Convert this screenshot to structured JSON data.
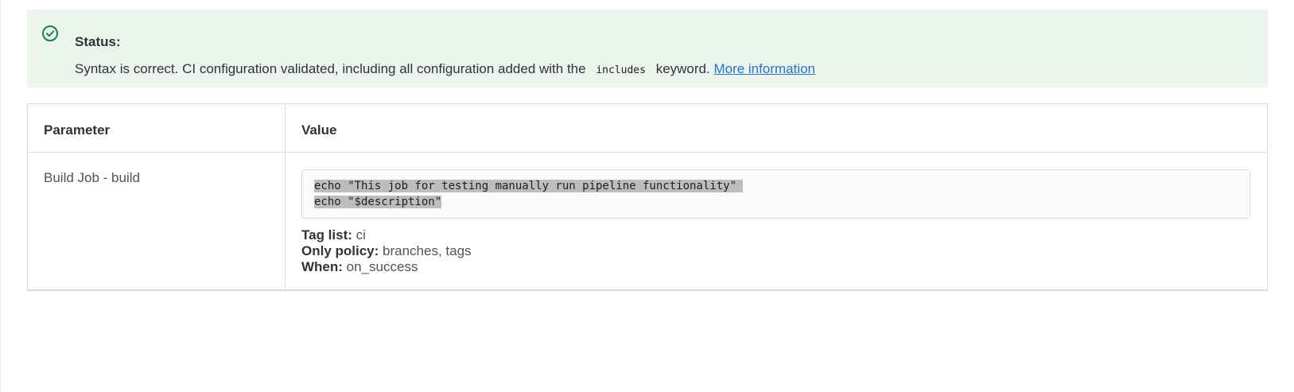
{
  "status": {
    "title": "Status:",
    "message_before": "Syntax is correct. CI configuration validated, including all configuration added with the",
    "keyword": "includes",
    "message_after": "keyword.",
    "link_text": "More information"
  },
  "table": {
    "headers": {
      "parameter": "Parameter",
      "value": "Value"
    },
    "rows": [
      {
        "parameter": "Build Job - build",
        "script_lines": [
          "echo \"This job for testing manually run pipeline functionality\" ",
          "echo \"$description\""
        ],
        "tag_list_label": "Tag list:",
        "tag_list_value": "ci",
        "only_policy_label": "Only policy:",
        "only_policy_value": "branches, tags",
        "when_label": "When:",
        "when_value": "on_success"
      }
    ]
  },
  "colors": {
    "success_bg": "#ecf4ee",
    "success_icon": "#108548",
    "link": "#1f75cb"
  },
  "icons": {
    "status": "check-circle-icon"
  }
}
